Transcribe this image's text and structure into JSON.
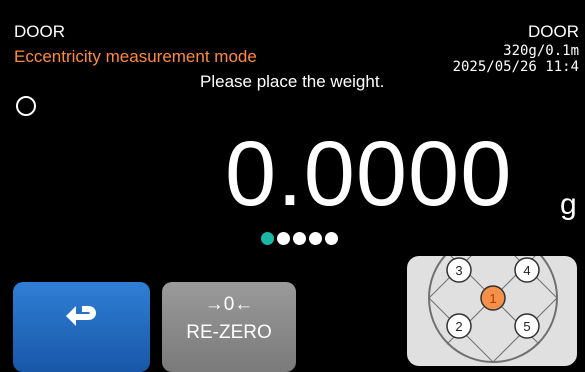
{
  "header": {
    "door_left": "DOOR",
    "door_right": "DOOR",
    "mode_title": "Eccentricity measurement mode",
    "capacity": "320g/0.1m",
    "datetime": "2025/05/26 11:4"
  },
  "instruction": "Please place the weight.",
  "display": {
    "value": "0.0000",
    "unit": "g",
    "stable": false
  },
  "progress": {
    "total_steps": 5,
    "current_step": 1
  },
  "buttons": {
    "back_icon": "return-arrow-icon",
    "rezero_symbol": "→0←",
    "rezero_label": "RE-ZERO"
  },
  "position_map": {
    "positions": [
      "1",
      "2",
      "3",
      "4",
      "5"
    ],
    "active_position": "1"
  },
  "colors": {
    "accent_orange": "#ff8a3d",
    "active_dot": "#1bb8a6",
    "back_button": "#2f7fd6",
    "rezero_button": "#8a8a8a",
    "active_position": "#f5904a"
  }
}
